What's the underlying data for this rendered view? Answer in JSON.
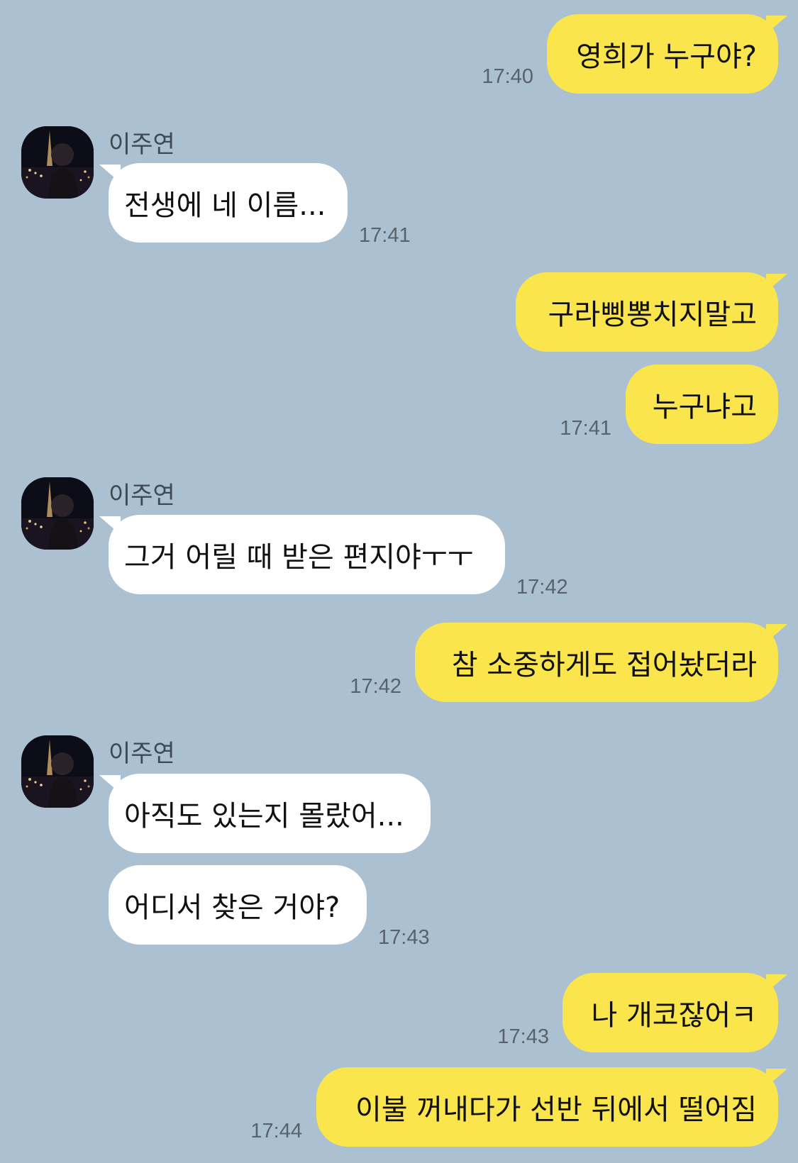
{
  "chat": {
    "contact_name": "이주연",
    "messages": [
      {
        "text": "영희가 누구야?",
        "time": "17:40"
      },
      {
        "text": "전생에 네 이름...",
        "time": "17:41"
      },
      {
        "text": "구라삥뽕치지말고"
      },
      {
        "text": "누구냐고",
        "time": "17:41"
      },
      {
        "text": "그거 어릴 때 받은 편지야ㅜㅜ",
        "time": "17:42"
      },
      {
        "text": "참 소중하게도 접어놨더라",
        "time": "17:42"
      },
      {
        "text": "아직도 있는지 몰랐어..."
      },
      {
        "text": "어디서 찾은 거야?",
        "time": "17:43"
      },
      {
        "text": "나 개코잖어ㅋ",
        "time": "17:43"
      },
      {
        "text": "이불 꺼내다가 선반 뒤에서 떨어짐",
        "time": "17:44"
      }
    ]
  },
  "colors": {
    "background": "#abc1d1",
    "my_bubble": "#fae54d",
    "their_bubble": "#ffffff"
  },
  "icons": {
    "avatar": "profile-photo-night-city"
  }
}
